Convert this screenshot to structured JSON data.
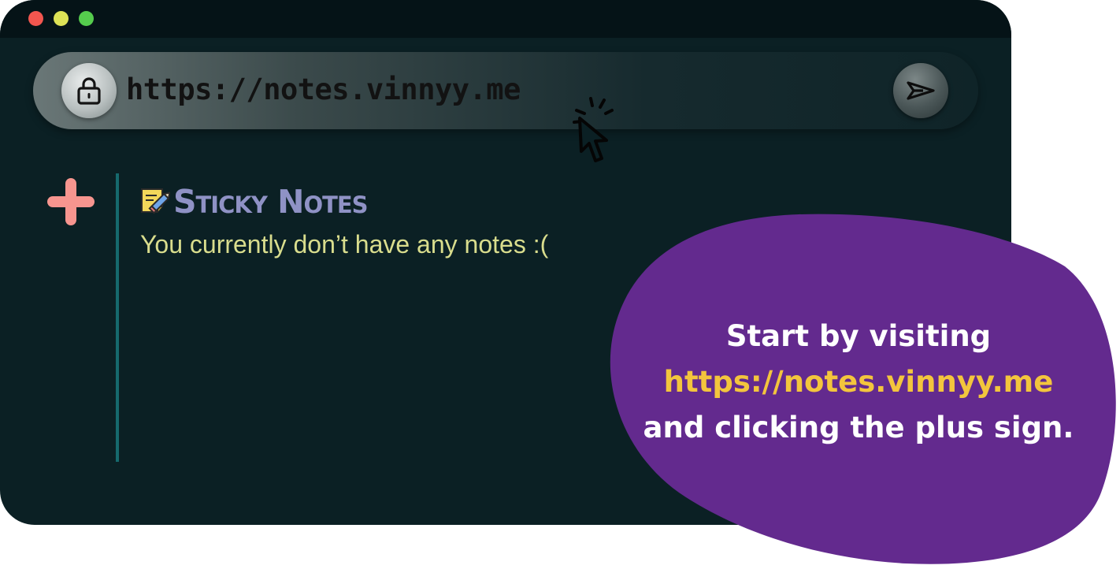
{
  "browser": {
    "window_controls": [
      "close",
      "minimize",
      "maximize"
    ],
    "address_bar": {
      "url": "https://notes.vinnyy.me",
      "lock_icon": "lock-icon",
      "go_icon": "send-arrow-icon"
    }
  },
  "app": {
    "add_button_icon": "plus-icon",
    "title_icon": "sticky-note-pencil-icon",
    "title": "Sticky Notes",
    "empty_message": "You currently don’t have any notes :("
  },
  "callout": {
    "line1": "Start by visiting",
    "link": "https://notes.vinnyy.me",
    "line3": "and clicking the plus sign."
  },
  "colors": {
    "window_bg": "#0b2024",
    "titlebar_bg": "#051317",
    "plus_accent": "#f7958f",
    "title_color": "#8f92c5",
    "message_color": "#d9dd8d",
    "callout_bg": "#632a8e",
    "callout_link": "#f3c53d"
  }
}
